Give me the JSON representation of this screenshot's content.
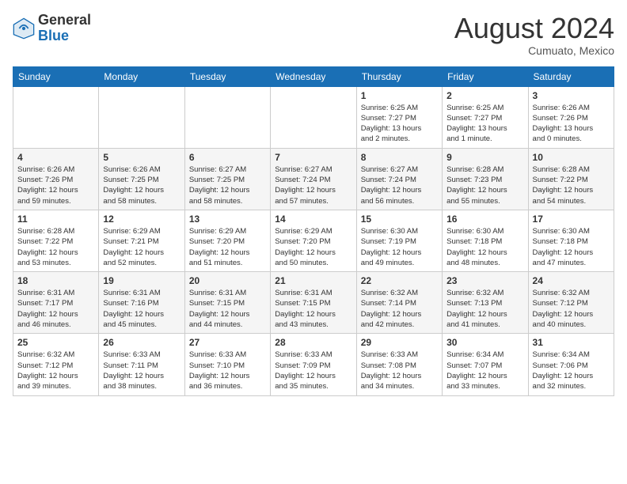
{
  "header": {
    "logo_general": "General",
    "logo_blue": "Blue",
    "month_year": "August 2024",
    "location": "Cumuato, Mexico"
  },
  "days_of_week": [
    "Sunday",
    "Monday",
    "Tuesday",
    "Wednesday",
    "Thursday",
    "Friday",
    "Saturday"
  ],
  "weeks": [
    {
      "days": [
        {
          "number": "",
          "info": ""
        },
        {
          "number": "",
          "info": ""
        },
        {
          "number": "",
          "info": ""
        },
        {
          "number": "",
          "info": ""
        },
        {
          "number": "1",
          "info": "Sunrise: 6:25 AM\nSunset: 7:27 PM\nDaylight: 13 hours\nand 2 minutes."
        },
        {
          "number": "2",
          "info": "Sunrise: 6:25 AM\nSunset: 7:27 PM\nDaylight: 13 hours\nand 1 minute."
        },
        {
          "number": "3",
          "info": "Sunrise: 6:26 AM\nSunset: 7:26 PM\nDaylight: 13 hours\nand 0 minutes."
        }
      ]
    },
    {
      "days": [
        {
          "number": "4",
          "info": "Sunrise: 6:26 AM\nSunset: 7:26 PM\nDaylight: 12 hours\nand 59 minutes."
        },
        {
          "number": "5",
          "info": "Sunrise: 6:26 AM\nSunset: 7:25 PM\nDaylight: 12 hours\nand 58 minutes."
        },
        {
          "number": "6",
          "info": "Sunrise: 6:27 AM\nSunset: 7:25 PM\nDaylight: 12 hours\nand 58 minutes."
        },
        {
          "number": "7",
          "info": "Sunrise: 6:27 AM\nSunset: 7:24 PM\nDaylight: 12 hours\nand 57 minutes."
        },
        {
          "number": "8",
          "info": "Sunrise: 6:27 AM\nSunset: 7:24 PM\nDaylight: 12 hours\nand 56 minutes."
        },
        {
          "number": "9",
          "info": "Sunrise: 6:28 AM\nSunset: 7:23 PM\nDaylight: 12 hours\nand 55 minutes."
        },
        {
          "number": "10",
          "info": "Sunrise: 6:28 AM\nSunset: 7:22 PM\nDaylight: 12 hours\nand 54 minutes."
        }
      ]
    },
    {
      "days": [
        {
          "number": "11",
          "info": "Sunrise: 6:28 AM\nSunset: 7:22 PM\nDaylight: 12 hours\nand 53 minutes."
        },
        {
          "number": "12",
          "info": "Sunrise: 6:29 AM\nSunset: 7:21 PM\nDaylight: 12 hours\nand 52 minutes."
        },
        {
          "number": "13",
          "info": "Sunrise: 6:29 AM\nSunset: 7:20 PM\nDaylight: 12 hours\nand 51 minutes."
        },
        {
          "number": "14",
          "info": "Sunrise: 6:29 AM\nSunset: 7:20 PM\nDaylight: 12 hours\nand 50 minutes."
        },
        {
          "number": "15",
          "info": "Sunrise: 6:30 AM\nSunset: 7:19 PM\nDaylight: 12 hours\nand 49 minutes."
        },
        {
          "number": "16",
          "info": "Sunrise: 6:30 AM\nSunset: 7:18 PM\nDaylight: 12 hours\nand 48 minutes."
        },
        {
          "number": "17",
          "info": "Sunrise: 6:30 AM\nSunset: 7:18 PM\nDaylight: 12 hours\nand 47 minutes."
        }
      ]
    },
    {
      "days": [
        {
          "number": "18",
          "info": "Sunrise: 6:31 AM\nSunset: 7:17 PM\nDaylight: 12 hours\nand 46 minutes."
        },
        {
          "number": "19",
          "info": "Sunrise: 6:31 AM\nSunset: 7:16 PM\nDaylight: 12 hours\nand 45 minutes."
        },
        {
          "number": "20",
          "info": "Sunrise: 6:31 AM\nSunset: 7:15 PM\nDaylight: 12 hours\nand 44 minutes."
        },
        {
          "number": "21",
          "info": "Sunrise: 6:31 AM\nSunset: 7:15 PM\nDaylight: 12 hours\nand 43 minutes."
        },
        {
          "number": "22",
          "info": "Sunrise: 6:32 AM\nSunset: 7:14 PM\nDaylight: 12 hours\nand 42 minutes."
        },
        {
          "number": "23",
          "info": "Sunrise: 6:32 AM\nSunset: 7:13 PM\nDaylight: 12 hours\nand 41 minutes."
        },
        {
          "number": "24",
          "info": "Sunrise: 6:32 AM\nSunset: 7:12 PM\nDaylight: 12 hours\nand 40 minutes."
        }
      ]
    },
    {
      "days": [
        {
          "number": "25",
          "info": "Sunrise: 6:32 AM\nSunset: 7:12 PM\nDaylight: 12 hours\nand 39 minutes."
        },
        {
          "number": "26",
          "info": "Sunrise: 6:33 AM\nSunset: 7:11 PM\nDaylight: 12 hours\nand 38 minutes."
        },
        {
          "number": "27",
          "info": "Sunrise: 6:33 AM\nSunset: 7:10 PM\nDaylight: 12 hours\nand 36 minutes."
        },
        {
          "number": "28",
          "info": "Sunrise: 6:33 AM\nSunset: 7:09 PM\nDaylight: 12 hours\nand 35 minutes."
        },
        {
          "number": "29",
          "info": "Sunrise: 6:33 AM\nSunset: 7:08 PM\nDaylight: 12 hours\nand 34 minutes."
        },
        {
          "number": "30",
          "info": "Sunrise: 6:34 AM\nSunset: 7:07 PM\nDaylight: 12 hours\nand 33 minutes."
        },
        {
          "number": "31",
          "info": "Sunrise: 6:34 AM\nSunset: 7:06 PM\nDaylight: 12 hours\nand 32 minutes."
        }
      ]
    }
  ]
}
